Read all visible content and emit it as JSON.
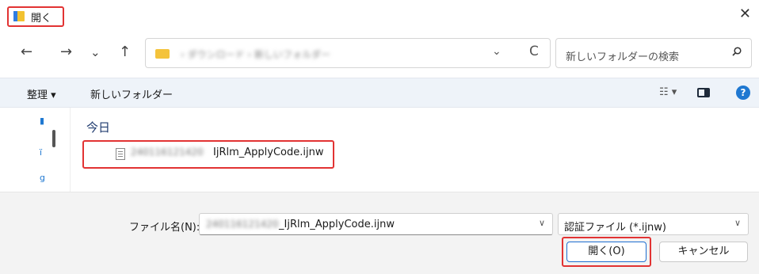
{
  "window": {
    "title": "開く",
    "close_glyph": "✕"
  },
  "nav": {
    "back": "←",
    "forward": "→",
    "recent": "⌄",
    "up": "↑",
    "address_path": "› ダウンロード › 新しいフォルダー",
    "address_chevron": "⌄",
    "refresh": "C",
    "search_placeholder": "新しいフォルダーの検索"
  },
  "toolbar": {
    "organize": "整理 ▾",
    "new_folder": "新しいフォルダー",
    "view": "☷ ▾",
    "help": "?"
  },
  "leftnav": {
    "glyph1": "▮",
    "glyph2": "ï",
    "glyph3": "g"
  },
  "content": {
    "group_header": "今日",
    "file": {
      "name_prefix": "240116121420",
      "name": "IjRlm_ApplyCode.ijnw"
    }
  },
  "bottom": {
    "file_name_label": "ファイル名(N):",
    "file_name_prefix": "240116121420",
    "file_name_value": "_IjRlm_ApplyCode.ijnw",
    "file_type": "認証ファイル (*.ijnw)",
    "dropdown_glyph": "∨",
    "open_button": "開く(O)",
    "cancel_button": "キャンセル"
  },
  "colors": {
    "highlight_border": "#e23333",
    "accent": "#1f78d1",
    "toolbar_bg": "#eef3f9",
    "bottom_bg": "#f3f3f3"
  }
}
